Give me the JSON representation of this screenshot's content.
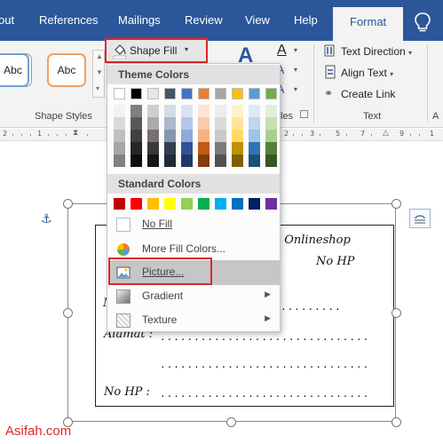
{
  "tabs": {
    "items": [
      "out",
      "References",
      "Mailings",
      "Review",
      "View",
      "Help"
    ],
    "active": "Format"
  },
  "ribbon": {
    "style_box_label": "Abc",
    "group_shape_styles": "Shape Styles",
    "group_styles_partial": "les",
    "group_text": "Text",
    "group_partial_a": "A",
    "text_direction": "Text Direction",
    "align_text": "Align Text",
    "create_link": "Create Link",
    "shape_fill": "Shape Fill",
    "caret": "▾"
  },
  "ruler": {
    "numbers": [
      "2",
      "1",
      "1",
      "2",
      "3",
      "4",
      "5",
      "6",
      "7",
      "8",
      "9",
      "1"
    ]
  },
  "menu": {
    "theme_colors_header": "Theme Colors",
    "standard_colors_header": "Standard Colors",
    "no_fill": "No Fill",
    "more_fill_colors": "More Fill Colors...",
    "picture": "Picture...",
    "gradient": "Gradient",
    "texture": "Texture",
    "submenu_arrow": "▶",
    "theme_top_row": [
      "#ffffff",
      "#000000",
      "#e7e6e6",
      "#44546a",
      "#4472c4",
      "#ed7d31",
      "#a5a5a5",
      "#ffc000",
      "#5b9bd5",
      "#70ad47"
    ],
    "theme_shades": [
      [
        "#f2f2f2",
        "#d9d9d9",
        "#bfbfbf",
        "#a6a6a6",
        "#808080"
      ],
      [
        "#7f7f7f",
        "#595959",
        "#404040",
        "#262626",
        "#0d0d0d"
      ],
      [
        "#d0cece",
        "#aeaaaa",
        "#757171",
        "#3a3838",
        "#171616"
      ],
      [
        "#d6dce4",
        "#adb9ca",
        "#8497b0",
        "#333f4f",
        "#222a35"
      ],
      [
        "#d9e2f3",
        "#b4c6e7",
        "#8eaadb",
        "#2f5496",
        "#1f3864"
      ],
      [
        "#fbe5d5",
        "#f7cbac",
        "#f4b183",
        "#c55a11",
        "#833c0b"
      ],
      [
        "#ededed",
        "#dbdbdb",
        "#c9c9c9",
        "#7b7b7b",
        "#525252"
      ],
      [
        "#fff2cc",
        "#fee599",
        "#ffd965",
        "#bf9000",
        "#7f6000"
      ],
      [
        "#deebf6",
        "#bdd7ee",
        "#9dc3e6",
        "#2e75b5",
        "#1f4e79"
      ],
      [
        "#e2efd9",
        "#c5e0b3",
        "#a8d08d",
        "#538135",
        "#375623"
      ]
    ],
    "standard": [
      "#c00000",
      "#ff0000",
      "#ffc000",
      "#ffff00",
      "#92d050",
      "#00b050",
      "#00b0f0",
      "#0070c0",
      "#002060",
      "#7030a0"
    ]
  },
  "document": {
    "shop_text": "pa Onlineshop",
    "no_hp_right": "No HP",
    "alamat": "Alamat :",
    "no_hp_label": "No HP :",
    "j_char": "J",
    "n_char": "N",
    "dots_long": "...............................",
    "dots_short": "........."
  },
  "watermark": "Asifah.com",
  "colors": {
    "accent": "#2b579a",
    "highlight_red": "#e0262b",
    "orange_box": "#f0a060",
    "blue_box": "#6fa0d8"
  }
}
